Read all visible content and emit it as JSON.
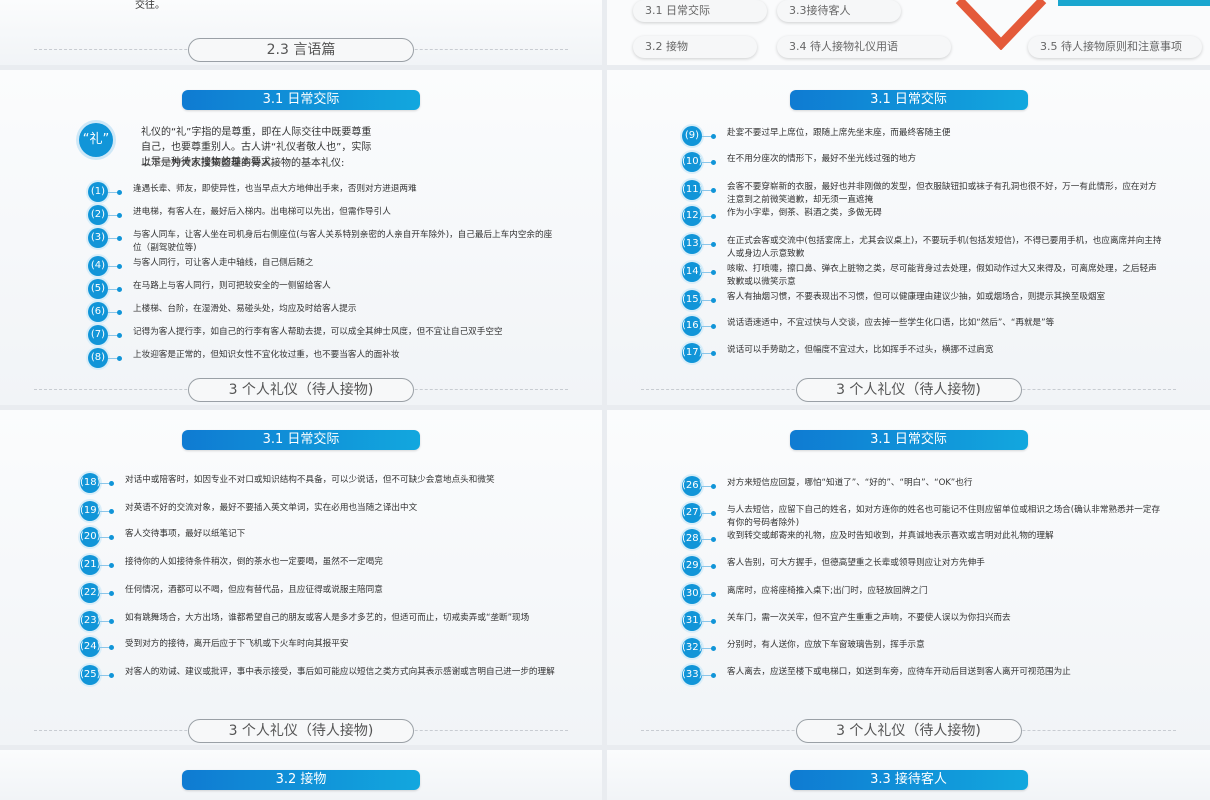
{
  "top_left": {
    "fragment": "交往。",
    "footer": "2.3  言语篇"
  },
  "top_right": {
    "toc": [
      "3.1 日常交际",
      "3.3接待客人",
      "3.2 接物",
      "3.4 待人接物礼仪用语",
      "3.5 待人接物原则和注意事项"
    ]
  },
  "slide1": {
    "title": "3.1  日常交际",
    "badge": "“礼”",
    "intro": [
      "礼仪的“礼”字指的是尊重，即在人际交往中既要尊重自己，也要尊重别人。古人讲“礼仪者敬人也”，实际上是一种待人接物的基本要求。",
      "以下是为大家搜集整理的待人接物的基本礼仪:"
    ],
    "items": [
      {
        "n": "(1)",
        "t": "逢遇长辈、师友，即使异性，也当早点大方地伸出手来，否则对方进退两难"
      },
      {
        "n": "(2)",
        "t": "进电梯，有客人在，最好后入梯内。出电梯可以先出，但需作导引人"
      },
      {
        "n": "(3)",
        "t": "与客人同车，让客人坐在司机身后右侧座位(与客人关系特别亲密的人亲自开车除外)，自己最后上车内空余的座位（副驾驶位等)"
      },
      {
        "n": "(4)",
        "t": "与客人同行，可让客人走中轴线，自己侧后随之"
      },
      {
        "n": "(5)",
        "t": "在马路上与客人同行，则可把较安全的一侧留给客人"
      },
      {
        "n": "(6)",
        "t": "上楼梯、台阶，在湿滑处、易碰头处，均应及时给客人提示"
      },
      {
        "n": "(7)",
        "t": "记得为客人提行李，如自己的行李有客人帮助去提，可以成全其绅士风度，但不宜让自己双手空空"
      },
      {
        "n": "(8)",
        "t": "上妆迎客是正常的，但知识女性不宜化妆过重，也不要当客人的面补妆"
      }
    ],
    "footer": "3  个人礼仪（待人接物)"
  },
  "slide2": {
    "title": "3.1  日常交际",
    "items": [
      {
        "n": "(9)",
        "t": "赴宴不要过早上席位，跟随上席先坐末座，而最终客随主便"
      },
      {
        "n": "(10)",
        "t": "在不用分座次的情形下，最好不坐光线过强的地方"
      },
      {
        "n": "(11)",
        "t": "会客不要穿崭新的衣服，最好也并非刚做的发型，但衣服缺钮扣或袜子有孔洞也很不好，万一有此情形，应在对方注意到之前微笑道歉，却无须一直遮掩"
      },
      {
        "n": "(12)",
        "t": "作为小字辈，倒茶、斟酒之类，多做无碍"
      },
      {
        "n": "(13)",
        "t": "在正式会客或交流中(包括宴席上，尤其会议桌上)，不要玩手机(包括发短信)，不得已要用手机，也应离席并向主持人或身边人示意致歉"
      },
      {
        "n": "(14)",
        "t": "咳嗽、打喷嚏，擦口鼻、弹衣上脏物之类，尽可能背身过去处理，假如动作过大又来得及，可离席处理，之后轻声致歉或以微笑示意"
      },
      {
        "n": "(15)",
        "t": "客人有抽烟习惯，不要表现出不习惯，但可以健康理由建议少抽，如或烟场合，则提示其换至吸烟室"
      },
      {
        "n": "(16)",
        "t": "说话语速适中，不宜过快与人交谈，应去掉一些学生化口语，比如“然后”、“再就是”等"
      },
      {
        "n": "(17)",
        "t": "说话可以手势助之，但幅度不宜过大，比如挥手不过头，横挪不过肩宽"
      }
    ],
    "footer": "3  个人礼仪（待人接物)"
  },
  "slide3": {
    "title": "3.1  日常交际",
    "items": [
      {
        "n": "(18)",
        "t": "对话中或陪客时，如因专业不对口或知识结构不具备，可以少说话，但不可缺少会意地点头和微笑"
      },
      {
        "n": "(19)",
        "t": "对英语不好的交流对象，最好不要插入英文单词，实在必用也当随之译出中文"
      },
      {
        "n": "(20)",
        "t": "客人交待事项，最好以纸笔记下"
      },
      {
        "n": "(21)",
        "t": "接待你的人如接待条件稍次，倒的茶水也一定要喝，虽然不一定喝完"
      },
      {
        "n": "(22)",
        "t": "任何情况，酒都可以不喝，但应有替代品，且应征得或说服主陪同意"
      },
      {
        "n": "(23)",
        "t": "如有跳舞场合，大方出场，谁都希望自己的朋友或客人是多才多艺的，但适可而止，切戒卖弄或“垄断”现场"
      },
      {
        "n": "(24)",
        "t": "受到对方的接待，离开后应于下飞机或下火车时向其报平安"
      },
      {
        "n": "(25)",
        "t": "对客人的劝诫、建议或批评，事中表示接受，事后如可能应以短信之类方式向其表示感谢或言明自己进一步的理解"
      }
    ],
    "footer": "3  个人礼仪（待人接物)"
  },
  "slide4": {
    "title": "3.1  日常交际",
    "items": [
      {
        "n": "(26)",
        "t": " 对方来短信应回复，哪怕“知道了”、“好的”、“明白”、“OK”也行"
      },
      {
        "n": "(27)",
        "t": "与人去短信，应留下自己的姓名，如对方连你的姓名也可能记不住则应留单位或相识之场合(确认非常熟悉并一定存有你的号码者除外)"
      },
      {
        "n": "(28)",
        "t": " 收到转交或邮寄来的礼物，应及时告知收到，并真诚地表示喜欢或言明对此礼物的理解"
      },
      {
        "n": "(29)",
        "t": "客人告别，可大方握手，但德高望重之长辈或领导则应让对方先伸手"
      },
      {
        "n": "(30)",
        "t": "离席时，应将座椅推入桌下;出门时，应轻放回牌之门"
      },
      {
        "n": "(31)",
        "t": "关车门，需一次关牢，但不宜产生重重之声响，不要使人误以为你扫兴而去"
      },
      {
        "n": "(32)",
        "t": "分别时，有人送你，应放下车窗玻璃告别，挥手示意"
      },
      {
        "n": "(33)",
        "t": "客人离去，应送至楼下或电梯口，如送到车旁，应待车开动后目送到客人离开可视范围为止"
      }
    ],
    "footer": "3  个人礼仪（待人接物)"
  },
  "bottom_left": {
    "title": "3.2  接物"
  },
  "bottom_right": {
    "title": "3.3  接待客人"
  },
  "colors": {
    "accent": "#1195d8",
    "accent_light": "#12a7de",
    "arrow": "#e45a3a",
    "teal": "#1aa6cf"
  }
}
